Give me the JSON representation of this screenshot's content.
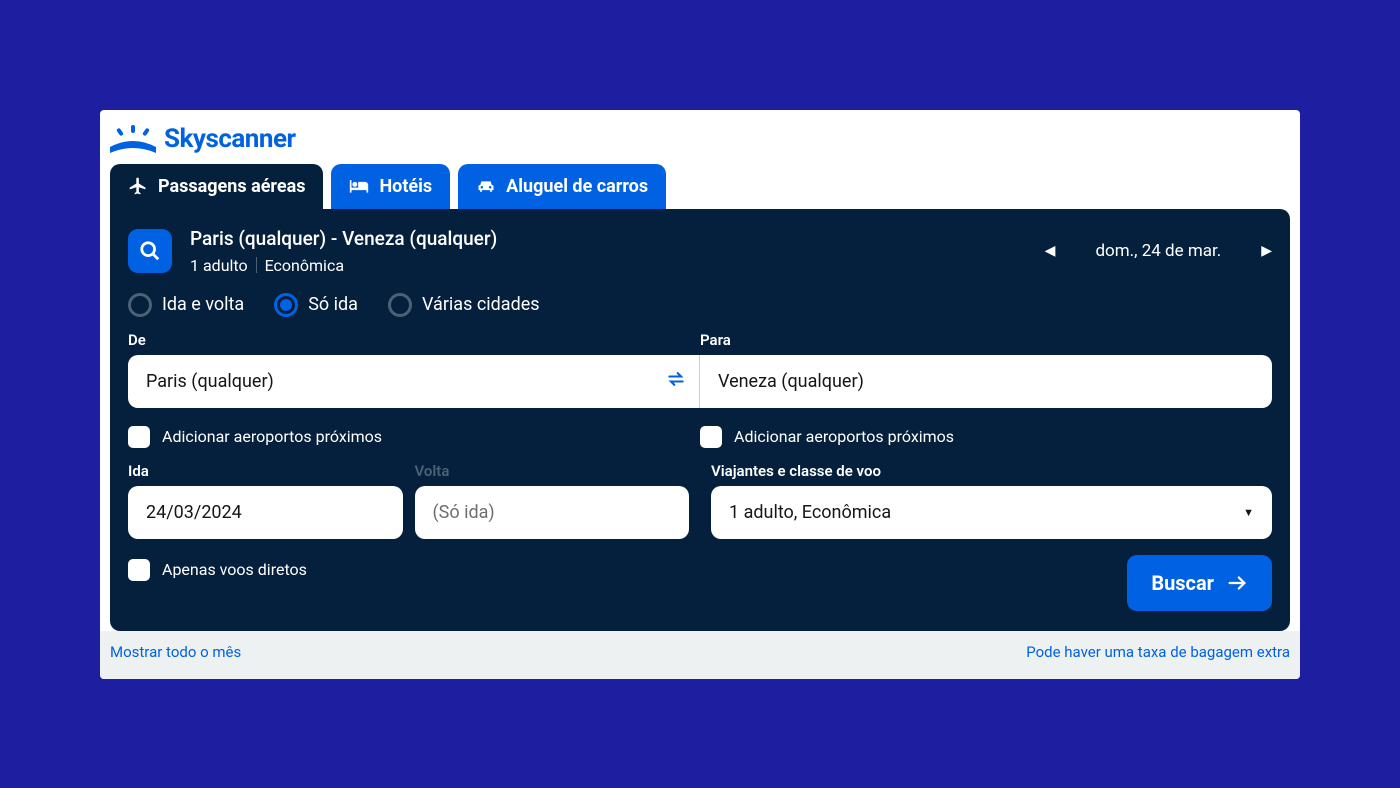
{
  "brand": "Skyscanner",
  "tabs": {
    "flights": "Passagens aéreas",
    "hotels": "Hotéis",
    "cars": "Aluguel de carros"
  },
  "summary": {
    "route": "Paris (qualquer) - Veneza (qualquer)",
    "pax": "1 adulto",
    "cabin": "Econômica",
    "date_label": "dom., 24 de mar."
  },
  "trip_types": {
    "roundtrip": "Ida e volta",
    "oneway": "Só ida",
    "multicity": "Várias cidades"
  },
  "labels": {
    "from": "De",
    "to": "Para",
    "depart": "Ida",
    "return": "Volta",
    "travelers": "Viajantes e classe de voo"
  },
  "values": {
    "from": "Paris (qualquer)",
    "to": "Veneza (qualquer)",
    "depart": "24/03/2024",
    "return_placeholder": "(Só ida)",
    "travelers": "1 adulto, Econômica"
  },
  "checkboxes": {
    "nearby_from": "Adicionar aeroportos próximos",
    "nearby_to": "Adicionar aeroportos próximos",
    "direct_only": "Apenas voos diretos"
  },
  "buttons": {
    "search": "Buscar"
  },
  "footer": {
    "show_month": "Mostrar todo o mês",
    "baggage_fee": "Pode haver uma taxa de bagagem extra"
  }
}
